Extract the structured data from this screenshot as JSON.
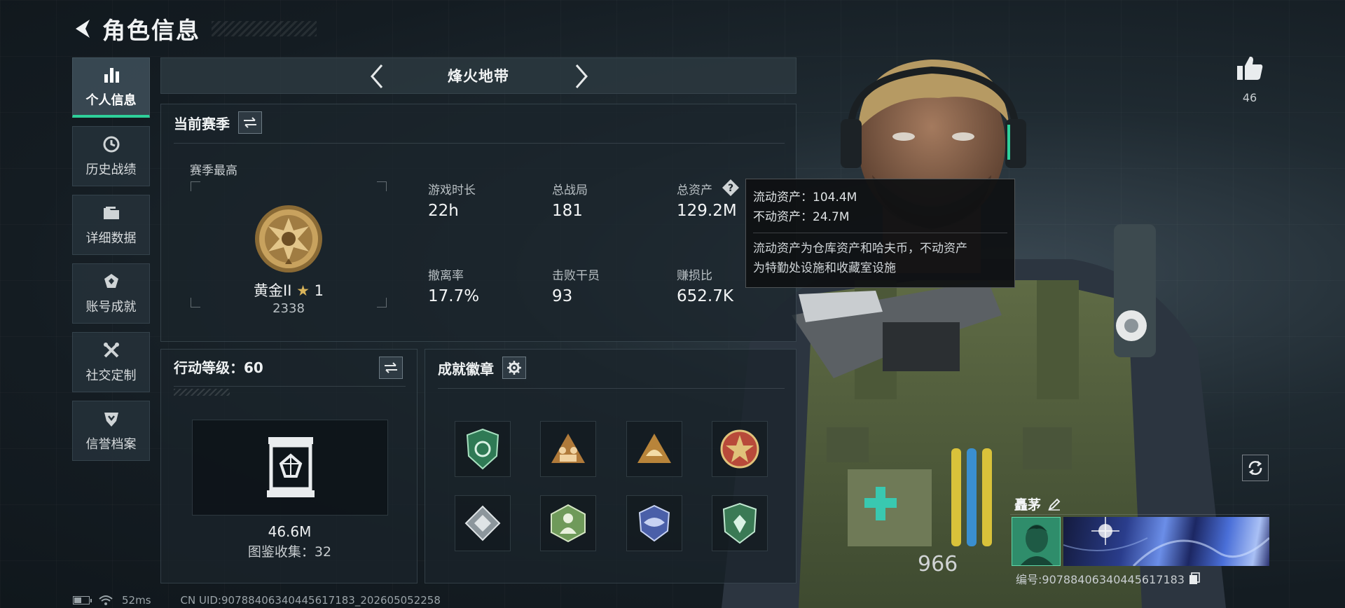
{
  "header": {
    "title": "角色信息"
  },
  "sidebar": {
    "items": [
      {
        "label": "个人信息",
        "icon": "bar-chart-icon",
        "active": true
      },
      {
        "label": "历史战绩",
        "icon": "history-icon"
      },
      {
        "label": "详细数据",
        "icon": "folder-icon"
      },
      {
        "label": "账号成就",
        "icon": "achievement-icon"
      },
      {
        "label": "社交定制",
        "icon": "tools-icon"
      },
      {
        "label": "信誉档案",
        "icon": "reputation-icon"
      }
    ]
  },
  "mode": {
    "title": "烽火地带"
  },
  "season": {
    "title": "当前赛季",
    "best_label": "赛季最高",
    "rank_name": "黄金II",
    "rank_stars": "1",
    "rank_score": "2338",
    "stats": [
      {
        "label": "游戏时长",
        "value": "22h"
      },
      {
        "label": "总战局",
        "value": "181"
      },
      {
        "label": "总资产",
        "value": "129.2M"
      },
      {
        "label": "撤离率",
        "value": "17.7%"
      },
      {
        "label": "击败干员",
        "value": "93"
      },
      {
        "label": "赚损比",
        "value": "652.7K"
      }
    ]
  },
  "tooltip": {
    "liquid": "流动资产：104.4M",
    "fixed": "不动资产：24.7M",
    "desc_line1": "流动资产为仓库资产和哈夫币，不动资产",
    "desc_line2": "为特勤处设施和收藏室设施"
  },
  "level": {
    "title": "行动等级：60",
    "value": "46.6M",
    "collection": "图鉴收集：32"
  },
  "badges": {
    "title": "成就徽章",
    "items": [
      {
        "icon": "green-shield-badge-icon",
        "color": "#2f7a55"
      },
      {
        "icon": "squad-badge-icon",
        "color": "#b07a3a"
      },
      {
        "icon": "helmet-triangle-badge-icon",
        "color": "#b8843a"
      },
      {
        "icon": "red-star-badge-icon",
        "color": "#b84a3a"
      },
      {
        "icon": "diamond-badge-icon",
        "color": "#8c969c"
      },
      {
        "icon": "soldier-hex-badge-icon",
        "color": "#6f9a5a"
      },
      {
        "icon": "blue-wing-badge-icon",
        "color": "#4a5fa8"
      },
      {
        "icon": "green-emblem-badge-icon",
        "color": "#3a7a55"
      }
    ]
  },
  "likes": {
    "count": "46"
  },
  "player": {
    "name": "矗茅",
    "id": "编号:907884063404456171​83"
  },
  "status": {
    "ping": "52ms",
    "uid": "CN UID:90788406340445617183_202605052258"
  },
  "colors": {
    "accent": "#2ed09a"
  }
}
